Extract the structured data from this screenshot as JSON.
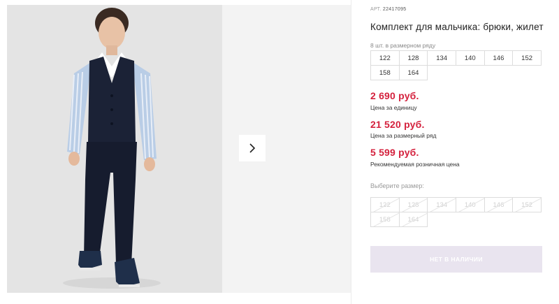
{
  "product": {
    "art_label": "АРТ.",
    "art_number": "22417095",
    "title": "Комплект для мальчика: брюки, жилет",
    "pack_note": "8 шт. в размерном ряду",
    "sizes": [
      "122",
      "128",
      "134",
      "140",
      "146",
      "152",
      "158",
      "164"
    ]
  },
  "prices": {
    "unit_price": "2 690 руб.",
    "unit_caption": "Цена за единицу",
    "row_price": "21 520 руб.",
    "row_caption": "Цена за размерный ряд",
    "retail_price": "5 599 руб.",
    "retail_caption": "Рекомендуемая розничная цена"
  },
  "size_selector": {
    "label": "Выберите размер:"
  },
  "buy_button": {
    "label": "НЕТ В НАЛИЧИИ"
  },
  "colors": {
    "price_red": "#d4213d",
    "button_bg": "#e9e4ef",
    "vest_navy": "#1b2236",
    "shirt_blue": "#b9cde6"
  },
  "icons": {
    "next": "chevron-right-icon"
  }
}
